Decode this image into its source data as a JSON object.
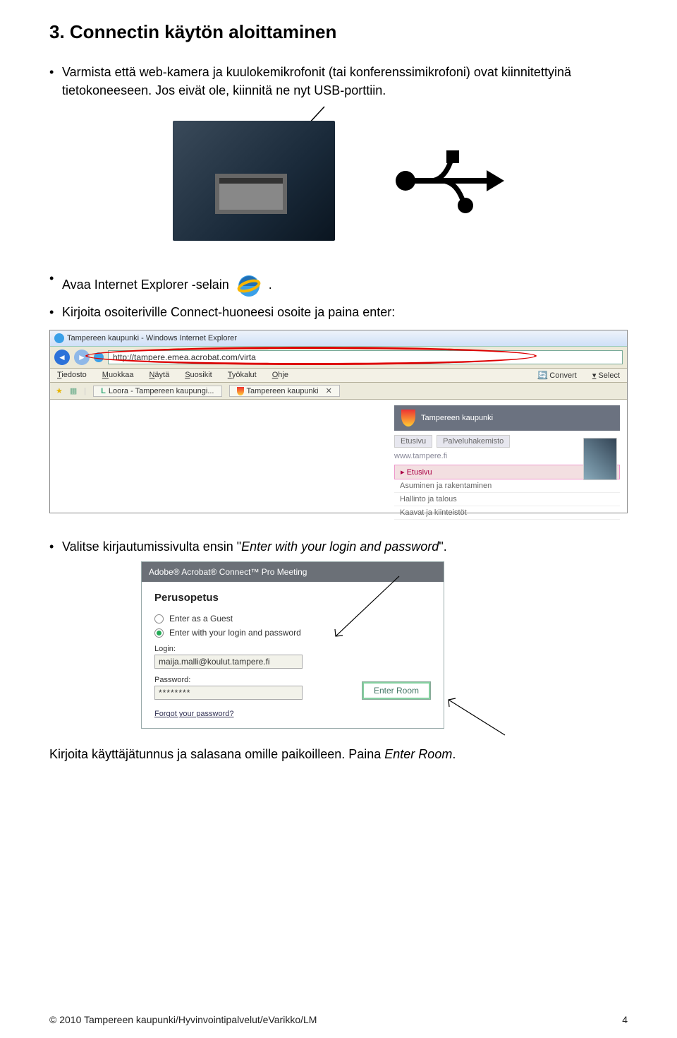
{
  "heading": "3. Connectin käytön aloittaminen",
  "bullets": {
    "b1": "Varmista että web-kamera ja kuulokemikrofonit (tai konferenssimikrofoni) ovat kiinnitettyinä tietokoneeseen. Jos eivät ole, kiinnitä ne nyt USB-porttiin.",
    "b2_pre": "Avaa Internet Explorer -selain",
    "b2_post": ".",
    "b3": "Kirjoita osoiteriville Connect-huoneesi osoite ja paina enter:",
    "b4_pre": "Valitse kirjautumissivulta ensin \"",
    "b4_italic": "Enter with your login and password",
    "b4_post": "\"."
  },
  "browser": {
    "title": "Tampereen kaupunki - Windows Internet Explorer",
    "url": "http://tampere.emea.acrobat.com/virta",
    "menu": [
      "Tiedosto",
      "Muokkaa",
      "Näytä",
      "Suosikit",
      "Työkalut",
      "Ohje"
    ],
    "convert": "Convert",
    "select": "Select",
    "tabs": [
      "Loora - Tampereen kaupungi...",
      "Tampereen kaupunki"
    ],
    "right": {
      "brand": "Tampereen kaupunki",
      "tab1": "Etusivu",
      "tab2": "Palveluhakemisto",
      "url": "www.tampere.fi",
      "active": "Etusivu",
      "items": [
        "Asuminen ja rakentaminen",
        "Hallinto ja talous",
        "Kaavat ja kiinteistöt"
      ]
    }
  },
  "login": {
    "title": "Adobe® Acrobat® Connect™ Pro Meeting",
    "heading": "Perusopetus",
    "opt_guest": "Enter as a Guest",
    "opt_login": "Enter with your login and password",
    "login_lbl": "Login:",
    "login_val": "maija.malli@koulut.tampere.fi",
    "pass_lbl": "Password:",
    "pass_val": "********",
    "button": "Enter Room",
    "forgot": "Forgot your password?"
  },
  "closingText_pre": "Kirjoita käyttäjätunnus ja salasana omille paikoilleen. Paina ",
  "closingText_italic": "Enter Room",
  "closingText_post": ".",
  "footer": {
    "left": "© 2010 Tampereen kaupunki/Hyvinvointipalvelut/eVarikko/LM",
    "right": "4"
  }
}
